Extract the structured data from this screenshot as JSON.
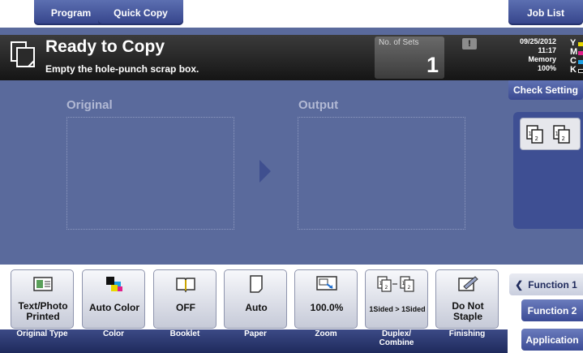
{
  "top_tabs": {
    "program": "Program",
    "quick_copy": "Quick Copy",
    "job_list": "Job List"
  },
  "status": {
    "title": "Ready to Copy",
    "message": "Empty the hole-punch scrap box.",
    "sets_label": "No. of Sets",
    "sets_value": "1",
    "alert_symbol": "!"
  },
  "info": {
    "date": "09/25/2012",
    "time": "11:17",
    "memory_label": "Memory",
    "memory_value": "100%",
    "toner": [
      {
        "letter": "Y",
        "color": "#e8d800"
      },
      {
        "letter": "M",
        "color": "#e0208a"
      },
      {
        "letter": "C",
        "color": "#1ea0e6"
      },
      {
        "letter": "K",
        "color": "#111111"
      }
    ]
  },
  "check_setting": "Check Setting",
  "main": {
    "original_label": "Original",
    "output_label": "Output"
  },
  "functions": [
    {
      "value": "Text/Photo\nPrinted",
      "caption": "Original Type",
      "icon": "original-type-icon"
    },
    {
      "value": "Auto Color",
      "caption": "Color",
      "icon": "color-icon"
    },
    {
      "value": "OFF",
      "caption": "Booklet",
      "icon": "booklet-icon"
    },
    {
      "value": "Auto",
      "caption": "Paper",
      "icon": "paper-icon"
    },
    {
      "value": "100.0%",
      "caption": "Zoom",
      "icon": "zoom-icon"
    },
    {
      "value": "1Sided > 1Sided",
      "caption": "Duplex/\nCombine",
      "icon": "duplex-icon"
    },
    {
      "value": "Do Not\nStaple",
      "caption": "Finishing",
      "icon": "finishing-icon"
    }
  ],
  "right_menu": {
    "function1": "Function 1",
    "function2": "Function 2",
    "application": "Application"
  },
  "colors": {
    "accent": "#3b4a91",
    "background": "#5a6a9c"
  }
}
